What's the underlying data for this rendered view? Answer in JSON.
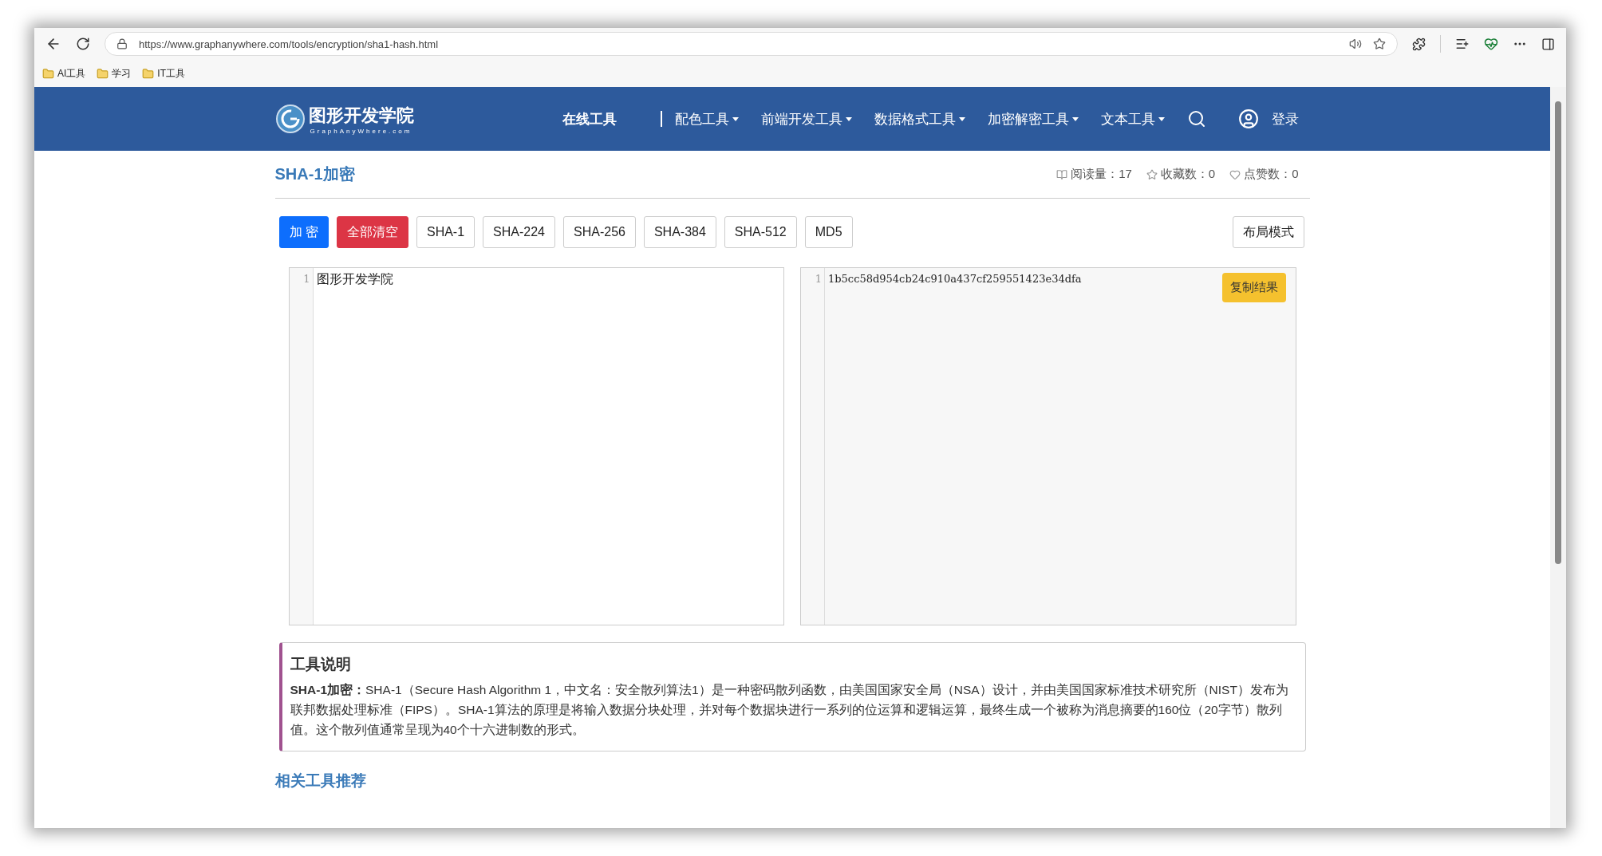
{
  "browser": {
    "url": "https://www.graphanywhere.com/tools/encryption/sha1-hash.html",
    "bookmarks": [
      "AI工具",
      "学习",
      "IT工具"
    ]
  },
  "site": {
    "logo_title": "图形开发学院",
    "logo_subtitle": "GraphAnyWhere.com",
    "nav": [
      {
        "label": "在线工具",
        "has_menu": false,
        "selected": true
      },
      {
        "label": "配色工具",
        "has_menu": true,
        "selected": false
      },
      {
        "label": "前端开发工具",
        "has_menu": true,
        "selected": false
      },
      {
        "label": "数据格式工具",
        "has_menu": true,
        "selected": false
      },
      {
        "label": "加密解密工具",
        "has_menu": true,
        "selected": false
      },
      {
        "label": "文本工具",
        "has_menu": true,
        "selected": false
      }
    ],
    "login": "登录"
  },
  "page": {
    "title": "SHA-1加密",
    "stats": [
      {
        "kind": "reads",
        "text": "阅读量：17"
      },
      {
        "kind": "favorites",
        "text": "收藏数：0"
      },
      {
        "kind": "likes",
        "text": "点赞数：0"
      }
    ],
    "buttons": [
      {
        "kind": "primary",
        "label": "加 密"
      },
      {
        "kind": "danger",
        "label": "全部清空"
      },
      {
        "kind": "outline",
        "label": "SHA-1"
      },
      {
        "kind": "outline",
        "label": "SHA-224"
      },
      {
        "kind": "outline",
        "label": "SHA-256"
      },
      {
        "kind": "outline",
        "label": "SHA-384"
      },
      {
        "kind": "outline",
        "label": "SHA-512"
      },
      {
        "kind": "outline",
        "label": "MD5"
      }
    ],
    "layout_button": "布局模式",
    "input_editor": {
      "lines": [
        {
          "number": "1",
          "text": "图形开发学院"
        }
      ]
    },
    "output_editor": {
      "lines": [
        {
          "number": "1",
          "text": "1b5cc58d954cb24c910a437cf259551423e34dfa"
        }
      ],
      "copy_button": "复制结果"
    },
    "description": {
      "title": "工具说明",
      "text": "**SHA-1加密：**SHA-1（Secure Hash Algorithm 1，中文名：安全散列算法1）是一种密码散列函数，由美国国家安全局（NSA）设计，并由美国国家标准技术研究所（NIST）发布为联邦数据处理标准（FIPS）。SHA-1算法的原理是将输入数据分块处理，并对每个数据块进行一系列的位运算和逻辑运算，最终生成一个被称为消息摘要的160位（20字节）散列值。这个散列值通常呈现为40个十六进制数的形式。"
    },
    "related_title": "相关工具推荐"
  }
}
